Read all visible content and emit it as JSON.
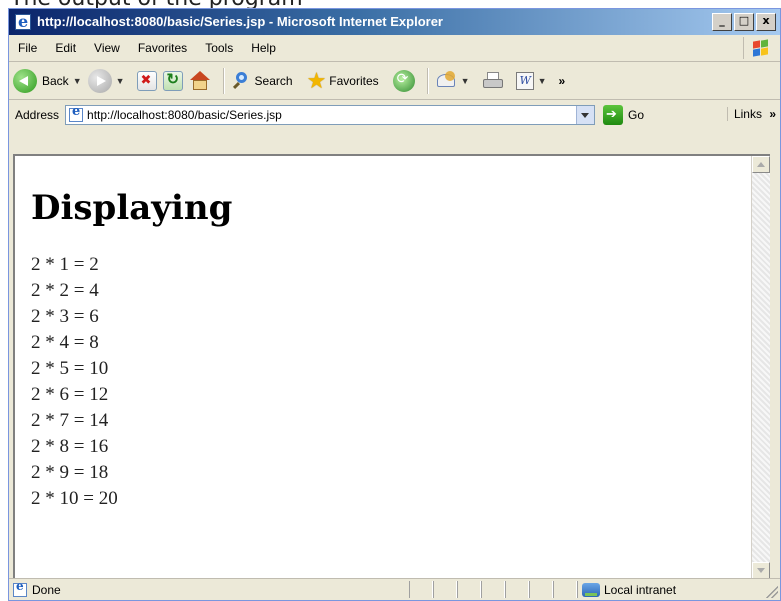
{
  "caption": "The output of the program",
  "window": {
    "title": "http://localhost:8080/basic/Series.jsp - Microsoft Internet Explorer",
    "buttons": [
      "_",
      "□",
      "x"
    ]
  },
  "menu": {
    "items": [
      "File",
      "Edit",
      "View",
      "Favorites",
      "Tools",
      "Help"
    ]
  },
  "toolbar": {
    "back_label": "Back",
    "search_label": "Search",
    "favorites_label": "Favorites",
    "overflow": "»"
  },
  "address": {
    "label": "Address",
    "url": "http://localhost:8080/basic/Series.jsp",
    "go_label": "Go",
    "links_label": "Links",
    "links_overflow": "»"
  },
  "page": {
    "heading": "Displaying",
    "lines": [
      "2 * 1 = 2",
      "2 * 2 = 4",
      "2 * 3 = 6",
      "2 * 4 = 8",
      "2 * 5 = 10",
      "2 * 6 = 12",
      "2 * 7 = 14",
      "2 * 8 = 16",
      "2 * 9 = 18",
      "2 * 10 = 20"
    ]
  },
  "status": {
    "text": "Done",
    "zone": "Local intranet"
  }
}
